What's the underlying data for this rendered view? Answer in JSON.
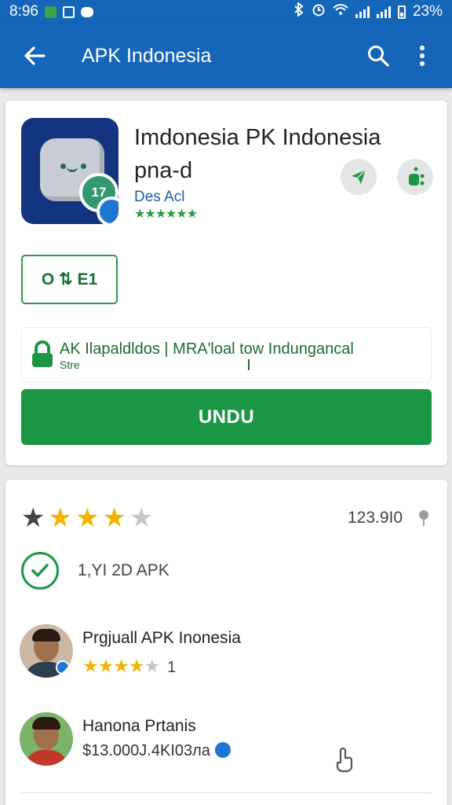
{
  "status_bar": {
    "time": "8:96",
    "battery": "23%",
    "icons": [
      "notification-app-icon",
      "notification-box-icon",
      "message-icon",
      "bluetooth-icon",
      "alarm-icon",
      "wifi-icon",
      "signal-icon",
      "signal-icon",
      "battery-icon"
    ]
  },
  "appbar": {
    "title": "APK Indonesia",
    "icons": [
      "back-arrow-icon",
      "search-icon",
      "more-vert-icon"
    ]
  },
  "app": {
    "title": "Imdonesia PK Indonesia pna-d",
    "developer": "Des Acl",
    "rating_stars": "★★★★★★",
    "icon_badge": "17",
    "action_icons": [
      "share-icon",
      "wishlist-icon"
    ]
  },
  "chip": {
    "label": "O ⇅ E1"
  },
  "info": {
    "main": "AK Ilapaldldos  |  MRA'loal tow Indungancal",
    "sub": "Stre"
  },
  "download": {
    "label": "UNDU"
  },
  "rating": {
    "stars_filled": 4,
    "stars_total": 5,
    "count": "123.9I0"
  },
  "verified": {
    "label": "1,YI 2D APK"
  },
  "reviews": [
    {
      "name": "Prgjuall APK Inonesia",
      "stars": "★★★★",
      "stars_off": "★",
      "number": "1"
    },
    {
      "name": "Hanona Prtanis",
      "amount": "$13.000J.4KI03лa"
    }
  ],
  "colors": {
    "primary_blue": "#1565b8",
    "accent_green": "#1a9644",
    "star_gold": "#f4b400"
  }
}
